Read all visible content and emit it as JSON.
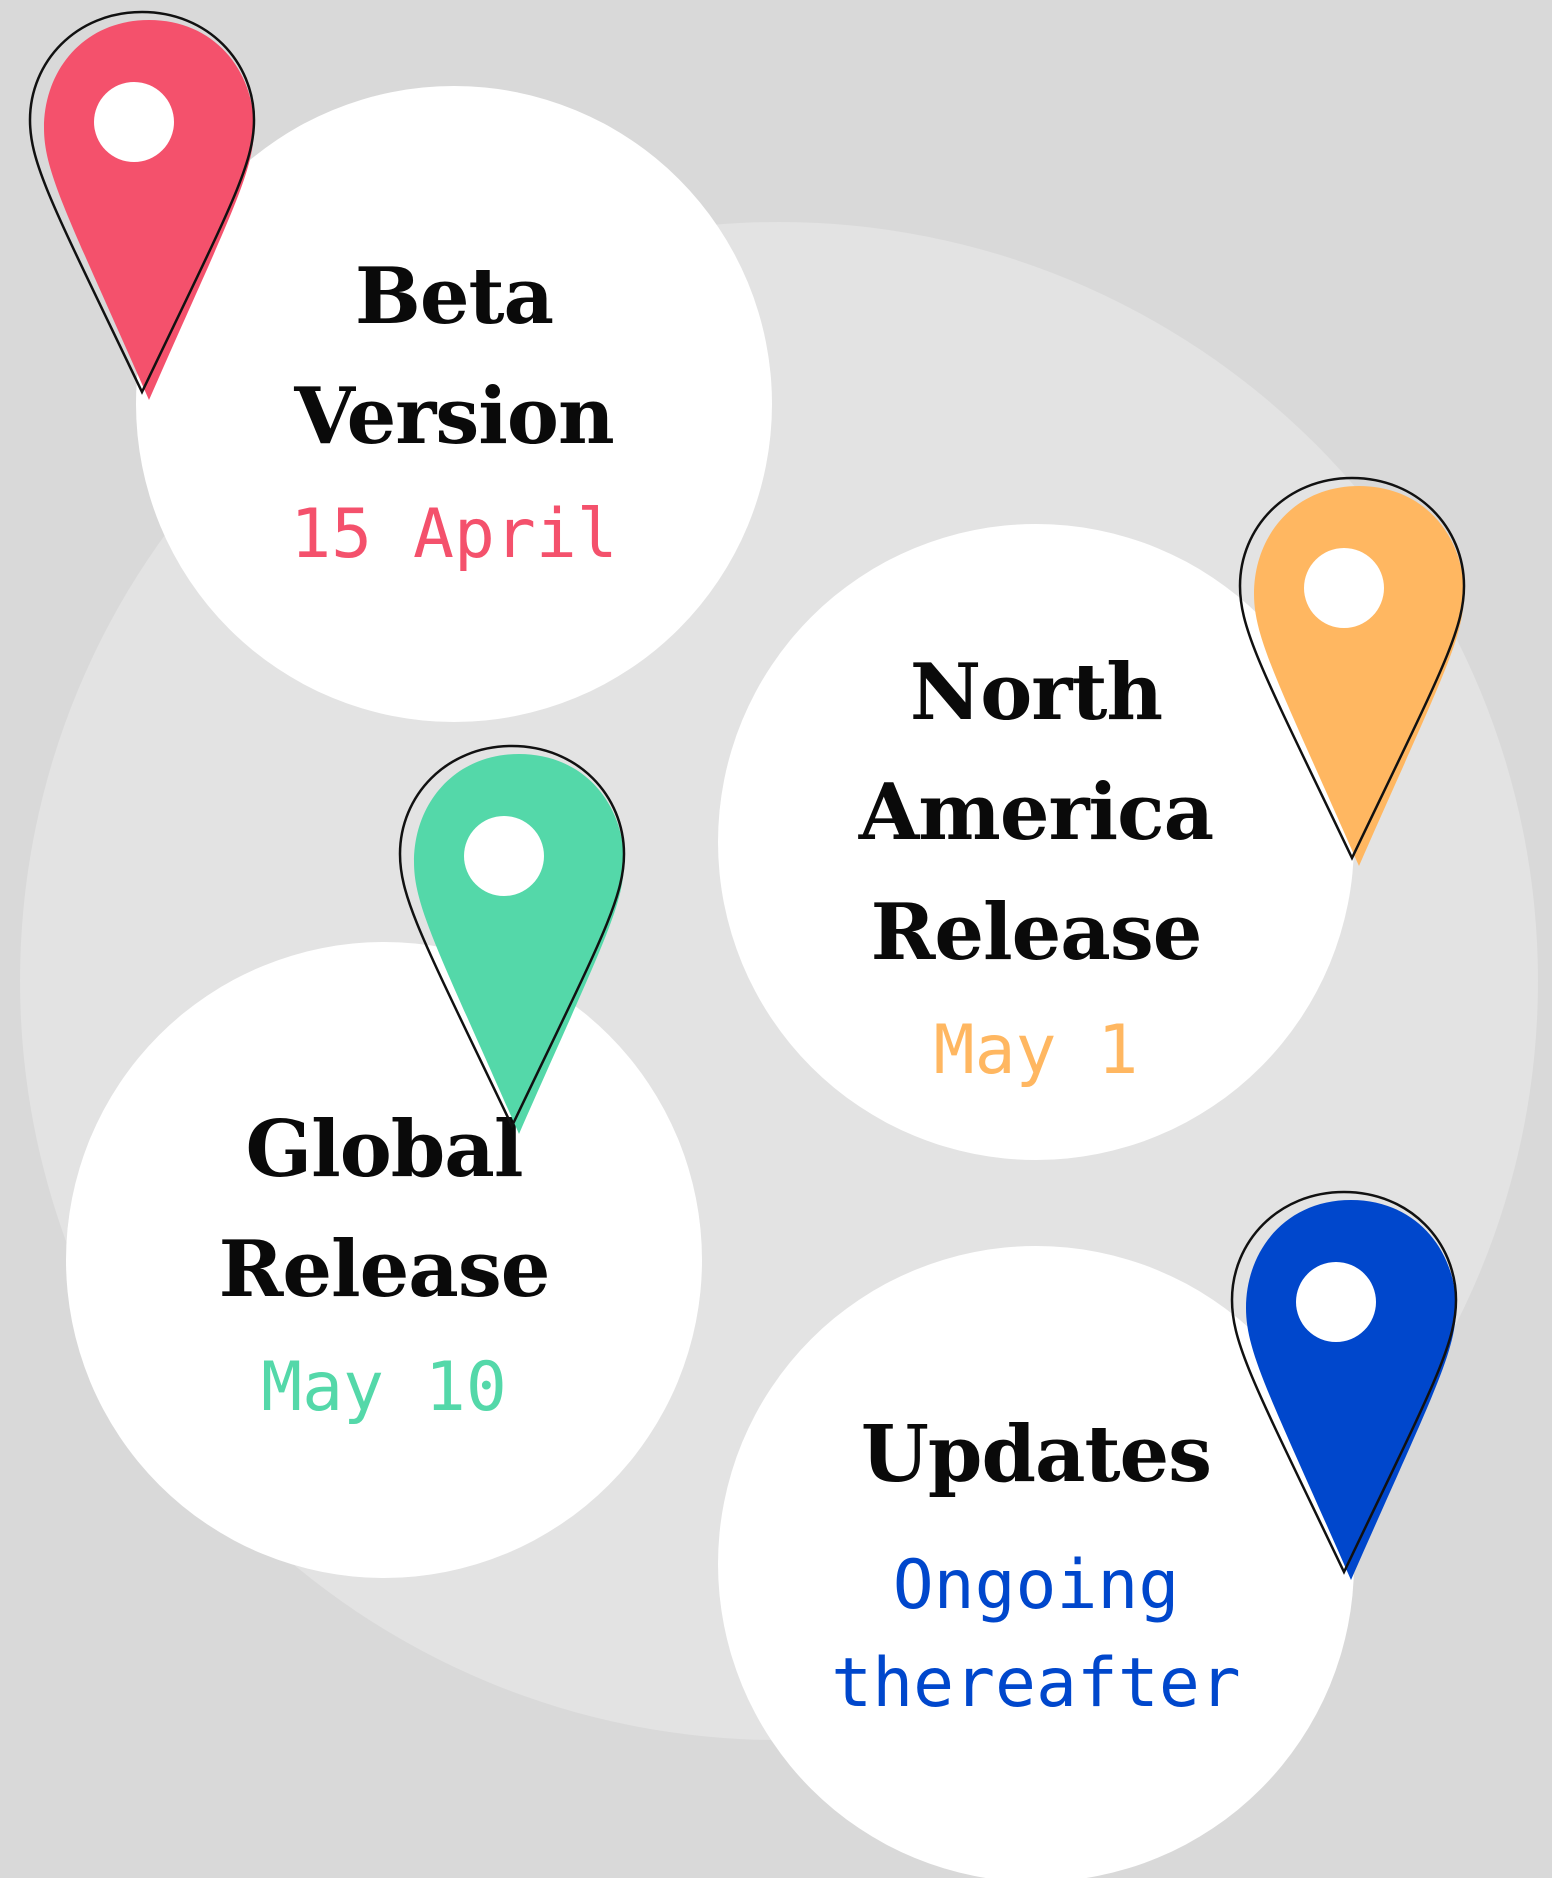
{
  "colors": {
    "background": "#d9d9d9",
    "disc": "#e3e3e3",
    "circle": "#ffffff",
    "title": "#0a0a0a",
    "outline": "#111111",
    "beta": "#f4516c",
    "north_america": "#ffb761",
    "global": "#54d8a9",
    "updates": "#0047cc"
  },
  "milestones": [
    {
      "title": [
        "Beta",
        "Version"
      ],
      "date": [
        "15 April"
      ],
      "color": "#f4516c",
      "icon": "map-pin-icon"
    },
    {
      "title": [
        "North",
        "America",
        "Release"
      ],
      "date": [
        "May 1"
      ],
      "color": "#ffb761",
      "icon": "map-pin-icon"
    },
    {
      "title": [
        "Global",
        "Release"
      ],
      "date": [
        "May 10"
      ],
      "color": "#54d8a9",
      "icon": "map-pin-icon"
    },
    {
      "title": [
        "Updates"
      ],
      "date": [
        "Ongoing",
        "thereafter"
      ],
      "color": "#0047cc",
      "icon": "map-pin-icon"
    }
  ]
}
